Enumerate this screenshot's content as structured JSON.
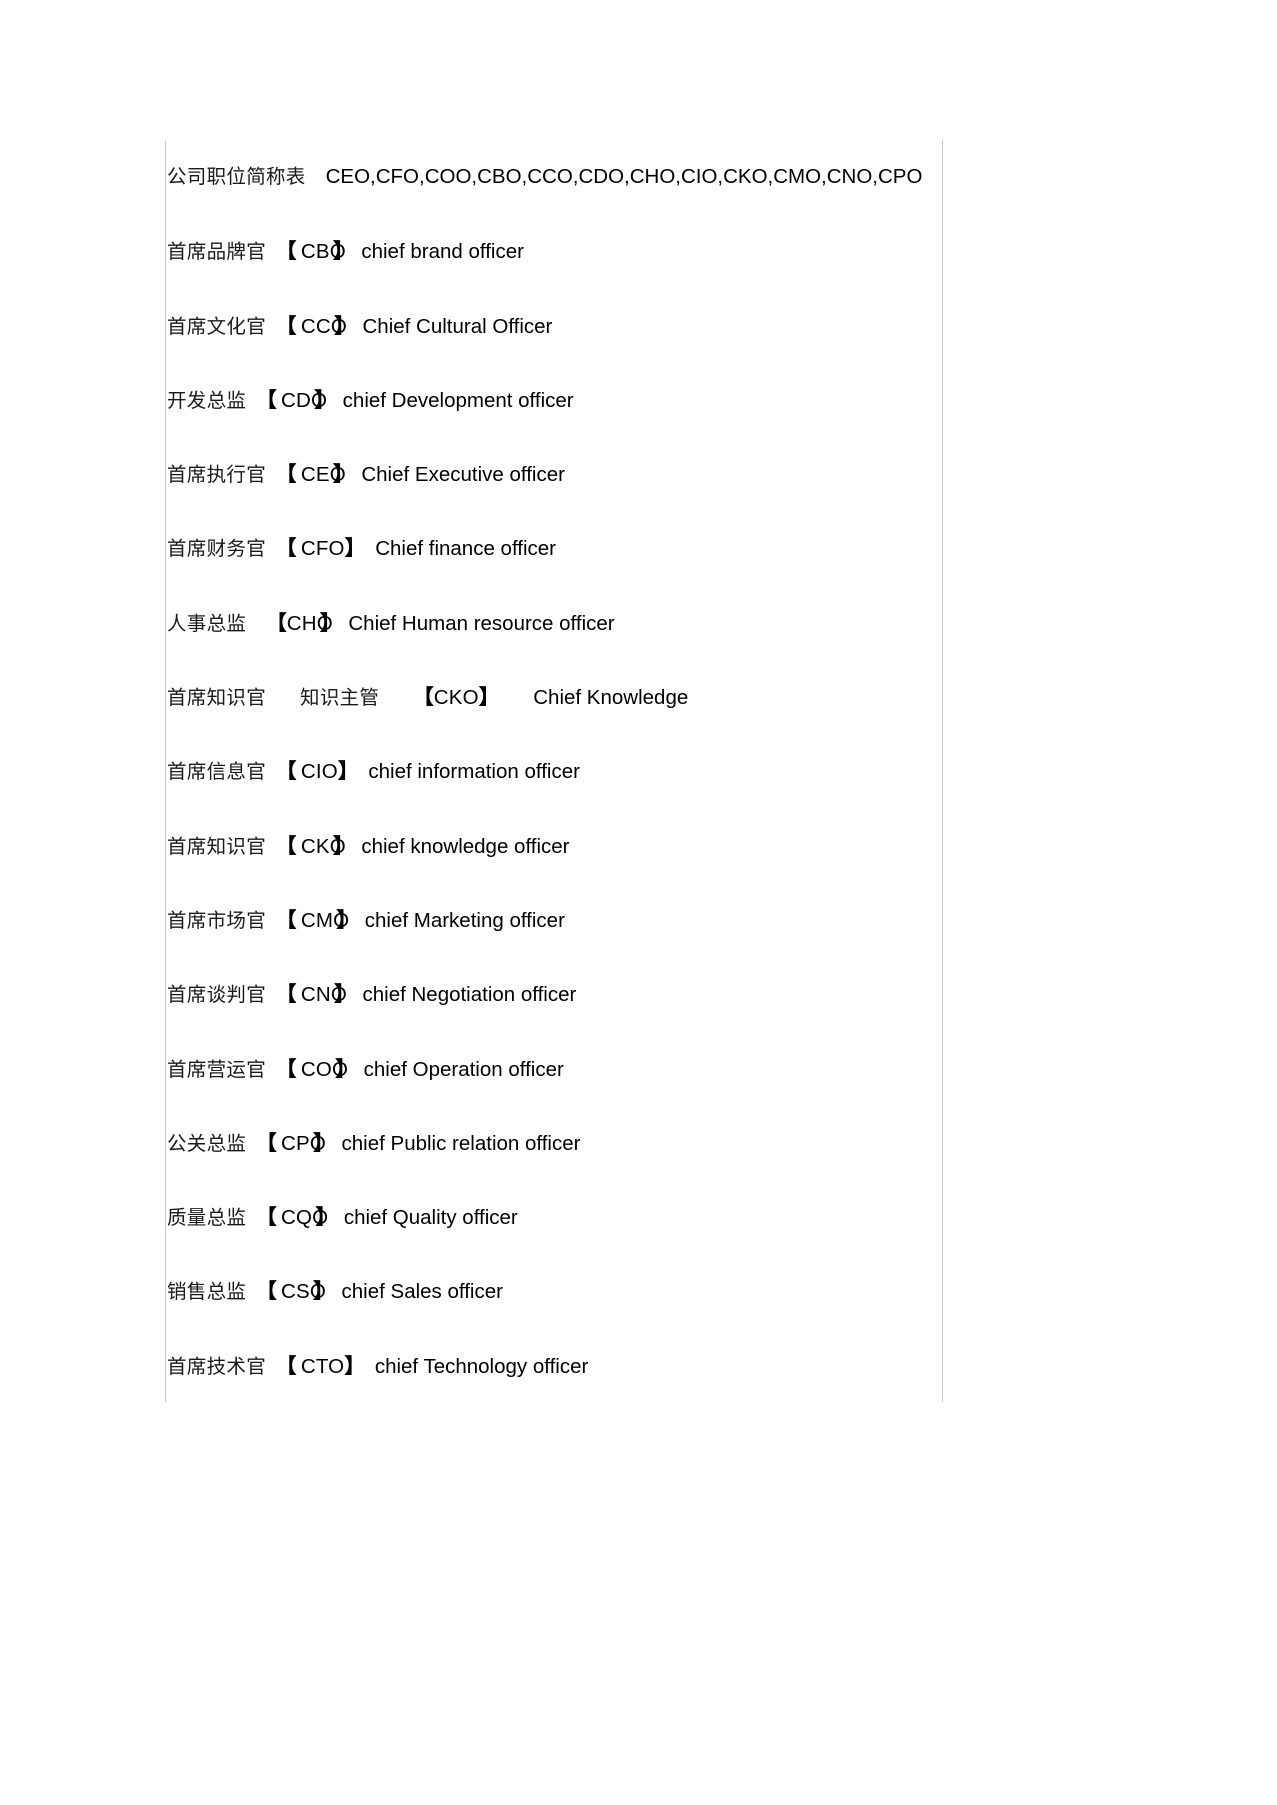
{
  "document": {
    "title": "公司职位简称表",
    "title_line": {
      "label": "公司职位简称表",
      "abbrev_list": "CEO,CFO,COO,CBO,CCO,CDO,CHO,CIO,CKO,CMO,CNO,CPO"
    },
    "bracket_open": "【",
    "bracket_close": "】",
    "entries": [
      {
        "cn": "首席品牌官",
        "code": "CBO",
        "en": "chief brand officer",
        "squeeze": true,
        "cn_gap": "none",
        "code_pad": true
      },
      {
        "cn": "首席文化官",
        "code": "CCO",
        "en": "Chief Cultural Officer",
        "squeeze": true,
        "cn_gap": "none",
        "code_pad": true
      },
      {
        "cn": "开发总监",
        "code": "CDO",
        "en": "chief Development officer",
        "squeeze": true,
        "cn_gap": "none",
        "code_pad": true
      },
      {
        "cn": "首席执行官",
        "code": "CEO",
        "en": "Chief Executive officer",
        "squeeze": true,
        "cn_gap": "none",
        "code_pad": true
      },
      {
        "cn": "首席财务官",
        "code": "CFO",
        "en": "Chief finance officer",
        "squeeze": false,
        "cn_gap": "none",
        "code_pad": true
      },
      {
        "cn": "人事总监",
        "code": "CHO",
        "en": "Chief Human resource officer",
        "squeeze": true,
        "cn_gap": "wide",
        "code_pad": false
      },
      {
        "cn": "首席知识官",
        "cn2": "知识主管",
        "code": "CKO",
        "en": "Chief Knowledge",
        "squeeze": false,
        "cn_gap": "xwide",
        "code_pad": false
      },
      {
        "cn": "首席信息官",
        "code": "CIO",
        "en": "chief information officer",
        "squeeze": false,
        "cn_gap": "none",
        "code_pad": true
      },
      {
        "cn": "首席知识官",
        "code": "CKO",
        "en": "chief knowledge officer",
        "squeeze": true,
        "cn_gap": "none",
        "code_pad": true
      },
      {
        "cn": "首席市场官",
        "code": "CMO",
        "en": "chief Marketing officer",
        "squeeze": true,
        "cn_gap": "none",
        "code_pad": true
      },
      {
        "cn": "首席谈判官",
        "code": "CNO",
        "en": "chief Negotiation officer",
        "squeeze": true,
        "cn_gap": "none",
        "code_pad": true
      },
      {
        "cn": "首席营运官",
        "code": "COO",
        "en": "chief Operation officer",
        "squeeze": true,
        "cn_gap": "none",
        "code_pad": true
      },
      {
        "cn": "公关总监",
        "code": "CPO",
        "en": "chief Public relation officer",
        "squeeze": true,
        "cn_gap": "none",
        "code_pad": true
      },
      {
        "cn": "质量总监",
        "code": "CQO",
        "en": "chief Quality officer",
        "squeeze": true,
        "cn_gap": "none",
        "code_pad": true
      },
      {
        "cn": "销售总监",
        "code": "CSO",
        "en": "chief Sales officer",
        "squeeze": true,
        "cn_gap": "none",
        "code_pad": true
      },
      {
        "cn": "首席技术官",
        "code": "CTO",
        "en": "chief Technology officer",
        "squeeze": false,
        "cn_gap": "none",
        "code_pad": true
      }
    ]
  }
}
